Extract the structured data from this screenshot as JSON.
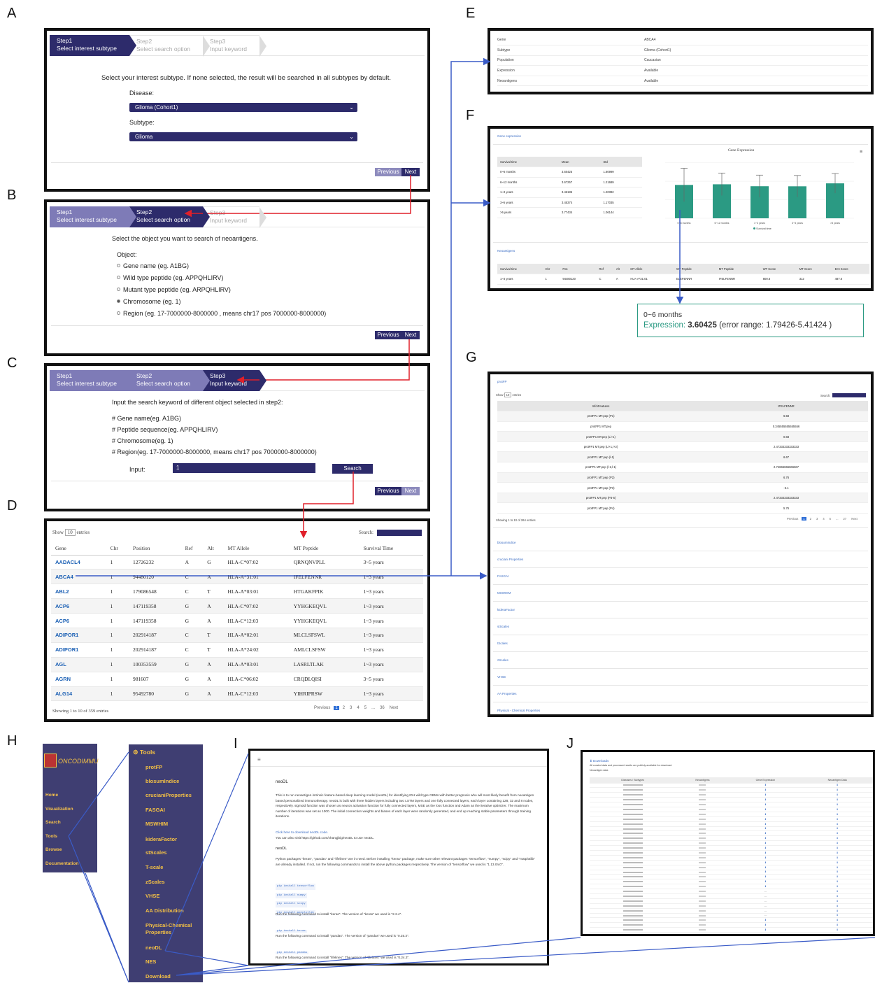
{
  "panel_letters": [
    "A",
    "B",
    "C",
    "D",
    "E",
    "F",
    "G",
    "H",
    "I",
    "J"
  ],
  "wizard": {
    "step1_num": "Step1",
    "step1_label": "Select interest subtype",
    "step2_num": "Step2",
    "step2_label": "Select search option",
    "step3_num": "Step3",
    "step3_label": "Input keyword",
    "previous": "Previous",
    "next": "Next"
  },
  "panelA": {
    "intro": "Select your interest subtype. If none selected, the result will be searched in all subtypes by default.",
    "disease_label": "Disease:",
    "disease_value": "Glioma (Cohort1)",
    "subtype_label": "Subtype:",
    "subtype_value": "Glioma"
  },
  "panelB": {
    "intro": "Select the object you want to search of neoantigens.",
    "object_label": "Object:",
    "options": [
      "Gene name (eg. A1BG)",
      "Wild type peptide (eg. APPQHLIRV)",
      "Mutant type peptide (eg. ARPQHLIRV)",
      "Chromosome (eg. 1)",
      "Region (eg. 17-7000000-8000000 , means chr17 pos 7000000-8000000)"
    ]
  },
  "panelC": {
    "intro": "Input the search keyword of different object selected in step2:",
    "lines": [
      "# Gene name(eg. A1BG)",
      "# Peptide sequence(eg. APPQHLIRV)",
      "# Chromosome(eg. 1)",
      "# Region(eg. 17-7000000-8000000, means chr17 pos 7000000-8000000)"
    ],
    "input_label": "Input:",
    "input_value": "1",
    "search": "Search"
  },
  "panelD": {
    "show": "Show",
    "show_value": "10",
    "entries": "entries",
    "search_label": "Search:",
    "columns": [
      "Gene",
      "Chr",
      "Position",
      "Ref",
      "Alt",
      "MT Allele",
      "MT Peptide",
      "Survival Time"
    ],
    "rows": [
      [
        "AADACL4",
        "1",
        "12726232",
        "A",
        "G",
        "HLA-C*07:02",
        "QRNQNVPLL",
        "3~5 years"
      ],
      [
        "ABCA4",
        "1",
        "94480120",
        "C",
        "A",
        "HLA-A*31:01",
        "IFELFENNR",
        "1~3 years"
      ],
      [
        "ABL2",
        "1",
        "179086548",
        "C",
        "T",
        "HLA-A*03:01",
        "HTGAKFPIK",
        "1~3 years"
      ],
      [
        "ACP6",
        "1",
        "147119358",
        "G",
        "A",
        "HLA-C*07:02",
        "YYHGKEQVL",
        "1~3 years"
      ],
      [
        "ACP6",
        "1",
        "147119358",
        "G",
        "A",
        "HLA-C*12:03",
        "YYHGKEQVL",
        "1~3 years"
      ],
      [
        "ADIPOR1",
        "1",
        "202914187",
        "C",
        "T",
        "HLA-A*02:01",
        "MLCLSFSWL",
        "1~3 years"
      ],
      [
        "ADIPOR1",
        "1",
        "202914187",
        "C",
        "T",
        "HLA-A*24:02",
        "AMLCLSFSW",
        "1~3 years"
      ],
      [
        "AGL",
        "1",
        "100353559",
        "G",
        "A",
        "HLA-A*03:01",
        "LASRLTLAK",
        "1~3 years"
      ],
      [
        "AGRN",
        "1",
        "981607",
        "G",
        "A",
        "HLA-C*06:02",
        "CRQDLQISI",
        "3~5 years"
      ],
      [
        "ALG14",
        "1",
        "95492780",
        "G",
        "A",
        "HLA-C*12:03",
        "YIHRIPRSW",
        "1~3 years"
      ]
    ],
    "footer": "Showing 1 to 10 of 359 entries",
    "pages": [
      "Previous",
      "1",
      "2",
      "3",
      "4",
      "5",
      "...",
      "36",
      "Next"
    ]
  },
  "panelE": {
    "rows": [
      [
        "Gene",
        "ABCA4"
      ],
      [
        "Subtype",
        "Glioma (Cohort1)"
      ],
      [
        "Population",
        "Caucasian"
      ],
      [
        "Expression",
        "Available"
      ],
      [
        "Neoantigens",
        "Available"
      ]
    ]
  },
  "panelF": {
    "section1": "Gene expression",
    "table_head": [
      "Survival time",
      "Mean",
      "Std"
    ],
    "table_rows": [
      [
        "0~6 months",
        "3.60425",
        "1.80999"
      ],
      [
        "6~12 months",
        "3.67257",
        "1.21689"
      ],
      [
        "1~3 years",
        "3.46185",
        "1.20392"
      ],
      [
        "3~5 years",
        "3.45374",
        "1.17035"
      ],
      [
        ">5 years",
        "3.77434",
        "1.06144"
      ]
    ],
    "chart_title": "Gene Expression",
    "legend": "Survival time",
    "section2": "Neoantigens",
    "neo_head": [
      "Survival time",
      "Chr",
      "Pos",
      "Ref",
      "Alt",
      "MT Allele",
      "WT Peptide",
      "MT Peptide",
      "WT Score",
      "MT Score",
      "DAI Score"
    ],
    "neo_row": [
      "1~3 years",
      "1",
      "94480120",
      "C",
      "A",
      "HLA-A*31:01",
      "ELEFENNR",
      "IFELFENNR",
      "800.6",
      "312",
      "487.6"
    ]
  },
  "tooltip": {
    "title": "0~6 months",
    "label": "Expression",
    "value": "3.60425",
    "range": "(error range: 1.79426-5.41424 )"
  },
  "chart_data": {
    "type": "bar",
    "title": "Gene Expression",
    "categories": [
      "0~6 months",
      "6~12 months",
      "1~3 years",
      "3~5 years",
      ">5 years"
    ],
    "series": [
      {
        "name": "Survival time",
        "values": [
          3.60425,
          3.67257,
          3.46185,
          3.45374,
          3.77434
        ],
        "std": [
          1.80999,
          1.21689,
          1.20392,
          1.17035,
          1.06144
        ]
      }
    ],
    "color": "#2b9a83"
  },
  "panelG": {
    "section": "protFP",
    "show": "Show",
    "show_value": "10",
    "entries": "entries",
    "search_label": "Search:",
    "head": [
      "Info\\Features",
      "IFELFENNR"
    ],
    "rows": [
      [
        "protFP1 MT.pep (P1)",
        "6.58"
      ],
      [
        "protFP1 MT.pep",
        "0.345555555555556"
      ],
      [
        "protFP1 MT.pep (Li+1)",
        "0.83"
      ],
      [
        "protFP1 MT.pep (Li+1,i+2)",
        "2.47333333333333"
      ],
      [
        "protFP1 MT.pep (l-1)",
        "6.67"
      ],
      [
        "protFP1 MT.pep (l-2,l-1)",
        "2.74666666666667"
      ],
      [
        "protFP1 MT.pep (P2)",
        "6.76"
      ],
      [
        "protFP1 MT.pep (P3)",
        "-3.1"
      ],
      [
        "protFP1 MT.pep (P3-5)",
        "2.47333333333333"
      ],
      [
        "protFP1 MT.pep (P4)",
        "5.76"
      ]
    ],
    "footer": "Showing 1 to 10 of 264 entries",
    "pages": [
      "Previous",
      "1",
      "2",
      "3",
      "4",
      "5",
      "...",
      "27",
      "Next"
    ],
    "sections": [
      "blosumIndice",
      "cruciani Properties",
      "FASGAI",
      "MSWHIM",
      "kideraFactor",
      "stScales",
      "tScales",
      "zScales",
      "VHSE",
      "AA Properties",
      "Physical - Chemical Properties"
    ]
  },
  "panelH": {
    "logo": "ONCODIMMU",
    "nav": [
      "Home",
      "Visualization",
      "Search",
      "Tools",
      "Browse",
      "Documentation"
    ],
    "tools_title": "Tools",
    "tools": [
      "protFP",
      "blosumIndice",
      "crucianiProperties",
      "FASGAI",
      "MSWHIM",
      "kideraFactor",
      "stScales",
      "T-scale",
      "zScales",
      "VHSE",
      "AA Distribution",
      "Physical-Chemical",
      "Properties",
      "neoDL",
      "NES",
      "Download"
    ]
  },
  "panelI": {
    "title": "neoDL",
    "para1": "This is to run neoantigen intrinsic feature-based deep learning model (neoDL) for identifying IDH wild type GBMs with better prognosis who will most likely benefit from neoantigen based personalized immunotherapy. neoDL is built with three hidden layers including two LSTM layers and one fully connected layers, each layer containing 128, 32 and 8 nodes, respectively. sigmoid function was chosen as neuron activation function for fully connected layers, MSE as the loss function and Adam as the iterative optimizer. The maximum number of iterations was set as 1000. The initial connection weights and biases of each layer were randomly generated, and end up reaching stable parameters through training iterations.",
    "link1": "Click here to download neoDL code.",
    "link2": "You can also visit https://github.com/zhangjbig/neoDL to use neoDL.",
    "subtitle": "neoDL",
    "para2": "Python packages \"keras\", \"pandas\" and \"lifelines\" are in need. Before installing \"keras\" package, make sure other relevant packages \"tensorflow\", \"numpy\", \"scipy\" and \"matplotlib\" are already installed. If not, run the following commands to install the above python packages respectively. The version of \"tensorflow\" we used is \"1.13.0rc0\".",
    "code1": [
      "pip install tensorflow",
      "pip install numpy",
      "pip install scipy",
      "pip install matplotlib"
    ],
    "para3": "Run the following command to install \"keras\". The version of \"keras\" we used is \"2.2.4\".",
    "code2": "pip install keras",
    "para4": "Run the following command to install \"pandas\". The version of \"pandas\" we used is \"0.25.3\".",
    "code3": "pip install pandas",
    "para5": "Run the following command to install \"lifelines\". The version of \"lifelines\" we used is \"0.24.3\"."
  },
  "panelJ": {
    "title": "Downloads",
    "subtitle": "All curated data and processed results are publicly available for download.",
    "section": "Neoantigen data",
    "head": [
      "Diseases / Subtypes",
      "Neoantigens",
      "Gene Expression",
      "Neoantigen Data"
    ]
  }
}
